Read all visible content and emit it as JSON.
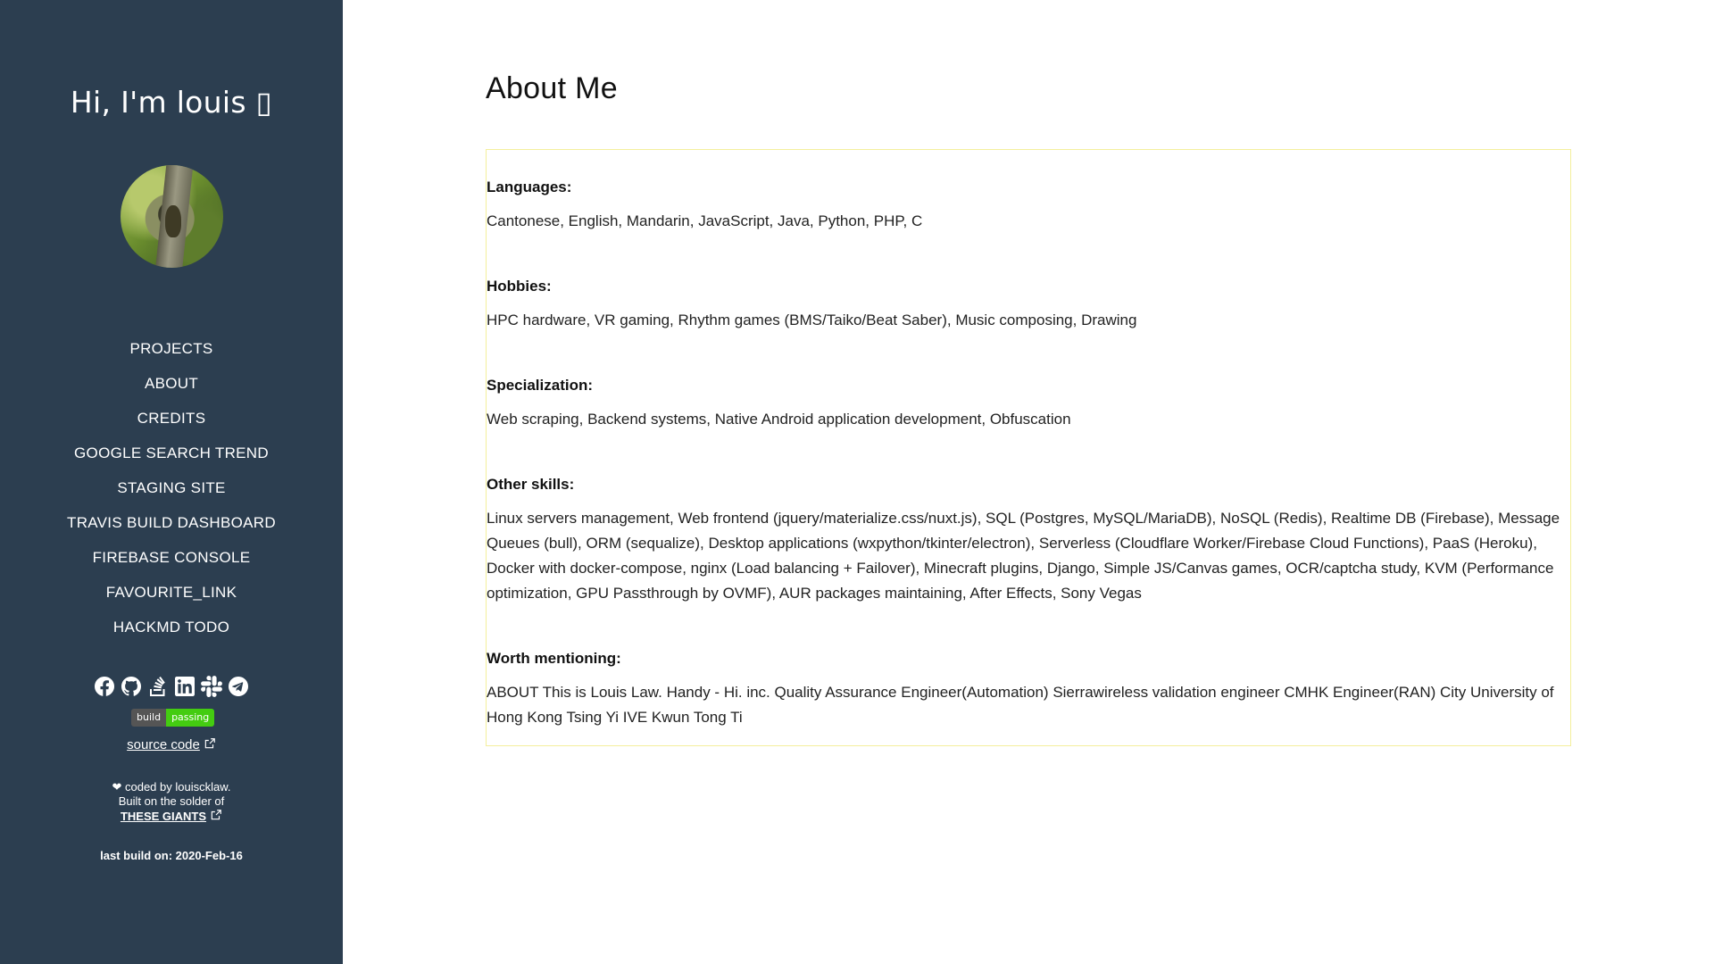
{
  "sidebar": {
    "greeting": "Hi, I'm louis ▯",
    "avatar_alt": "avatar",
    "nav": [
      {
        "label": "PROJECTS"
      },
      {
        "label": "ABOUT"
      },
      {
        "label": "CREDITS"
      },
      {
        "label": "GOOGLE SEARCH TREND"
      },
      {
        "label": "STAGING SITE"
      },
      {
        "label": "TRAVIS BUILD DASHBOARD"
      },
      {
        "label": "FIREBASE CONSOLE"
      },
      {
        "label": "FAVOURITE_LINK"
      },
      {
        "label": "HACKMD TODO"
      }
    ],
    "social_icons": [
      "facebook-icon",
      "github-icon",
      "stackoverflow-icon",
      "linkedin-icon",
      "slack-icon",
      "telegram-icon"
    ],
    "badge": {
      "left": "build",
      "right": "passing"
    },
    "source_label": "source code",
    "footer_line1": "❤ coded by louiscklaw.",
    "footer_line2": "Built on the solder of",
    "giants_label": "THESE GIANTS",
    "build_date": "last build on: 2020-Feb-16"
  },
  "main": {
    "title": "About Me",
    "sections": [
      {
        "heading": "Languages:",
        "text": "Cantonese, English, Mandarin, JavaScript, Java, Python, PHP, C"
      },
      {
        "heading": "Hobbies:",
        "text": "HPC hardware, VR gaming, Rhythm games (BMS/Taiko/Beat Saber), Music composing, Drawing"
      },
      {
        "heading": "Specialization:",
        "text": "Web scraping, Backend systems, Native Android application development, Obfuscation"
      },
      {
        "heading": "Other skills:",
        "text": "Linux servers management, Web frontend (jquery/materialize.css/nuxt.js), SQL (Postgres, MySQL/MariaDB), NoSQL (Redis), Realtime DB (Firebase), Message Queues (bull), ORM (sequalize), Desktop applications (wxpython/tkinter/electron), Serverless (Cloudflare Worker/Firebase Cloud Functions), PaaS (Heroku), Docker with docker-compose, nginx (Load balancing + Failover), Minecraft plugins, Django, Simple JS/Canvas games, OCR/captcha study, KVM (Performance optimization, GPU Passthrough by OVMF), AUR packages maintaining, After Effects, Sony Vegas"
      },
      {
        "heading": "Worth mentioning:",
        "text": "ABOUT This is Louis Law. Handy - Hi. inc. Quality Assurance Engineer(Automation) Sierrawireless validation engineer CMHK Engineer(RAN) City University of Hong Kong Tsing Yi IVE Kwun Tong Ti"
      }
    ]
  },
  "colors": {
    "sidebar_bg": "#2c3e50",
    "panel_border": "#f4ef9c",
    "badge_pass": "#44cc11"
  }
}
